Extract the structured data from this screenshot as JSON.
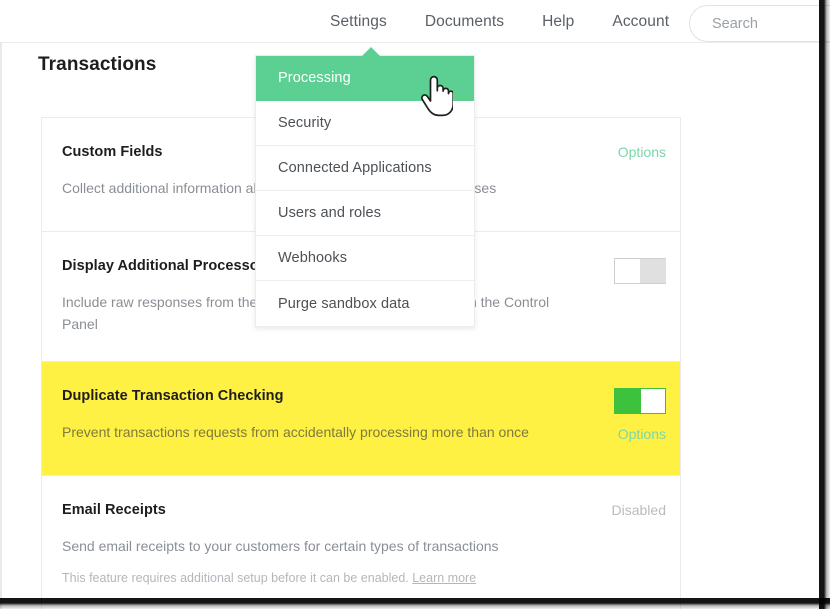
{
  "topnav": {
    "items": [
      {
        "label": "Settings",
        "active": true
      },
      {
        "label": "Documents",
        "active": false
      },
      {
        "label": "Help",
        "active": false
      },
      {
        "label": "Account",
        "active": false
      }
    ],
    "search": {
      "placeholder": "Search",
      "value": ""
    }
  },
  "page": {
    "title": "Transactions"
  },
  "dropdown": {
    "items": [
      {
        "label": "Processing",
        "active": true
      },
      {
        "label": "Security",
        "active": false
      },
      {
        "label": "Connected Applications",
        "active": false
      },
      {
        "label": "Users and roles",
        "active": false
      },
      {
        "label": "Webhooks",
        "active": false
      },
      {
        "label": "Purge sandbox data",
        "active": false
      }
    ]
  },
  "settings": {
    "rows": [
      {
        "title": "Custom Fields",
        "description": "Collect additional information about your customers or their purchases",
        "note": "",
        "note_link": "",
        "options_label": "Options",
        "status_label": "",
        "toggle": null,
        "highlight": false
      },
      {
        "title": "Display Additional Processor Response Information",
        "description": "Include raw responses from the processor with your transactions in the Control Panel",
        "note": "",
        "note_link": "",
        "options_label": "",
        "status_label": "",
        "toggle": "off",
        "highlight": false
      },
      {
        "title": "Duplicate Transaction Checking",
        "description": "Prevent transactions requests from accidentally processing more than once",
        "note": "",
        "note_link": "",
        "options_label": "Options",
        "status_label": "",
        "toggle": "on",
        "highlight": true
      },
      {
        "title": "Email Receipts",
        "description": "Send email receipts to your customers for certain types of transactions",
        "note": "This feature requires additional setup before it can be enabled. ",
        "note_link": "Learn more",
        "options_label": "",
        "status_label": "Disabled",
        "toggle": null,
        "highlight": false
      }
    ]
  },
  "colors": {
    "accent_green": "#5ccf92",
    "toggle_on_green": "#3cc23c",
    "highlight_yellow": "#fff144",
    "options_link": "#7bd6ab",
    "muted_text": "#8a8f95"
  }
}
